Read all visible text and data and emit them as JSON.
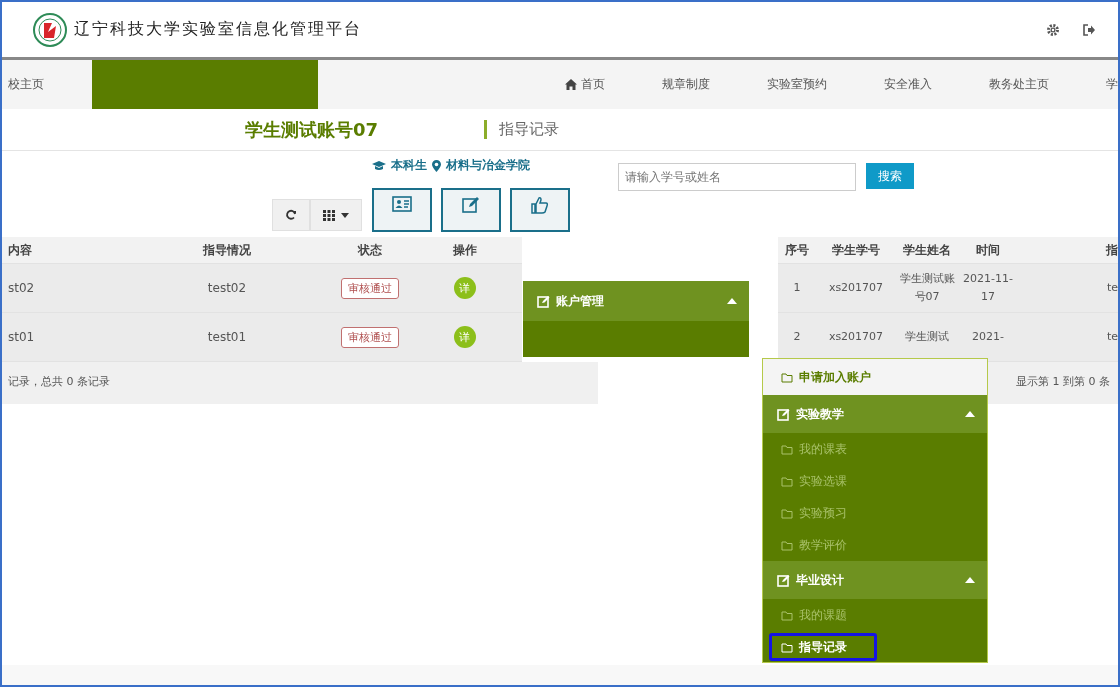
{
  "header": {
    "title": "辽宁科技大学实验室信息化管理平台"
  },
  "nav": {
    "items": [
      {
        "label": "校主页",
        "kind": "link"
      },
      {
        "label": "首页",
        "kind": "home"
      },
      {
        "label": "规章制度",
        "kind": "link"
      },
      {
        "label": "实验室预约",
        "kind": "link"
      },
      {
        "label": "安全准入",
        "kind": "link"
      },
      {
        "label": "教务处主页",
        "kind": "link"
      },
      {
        "label": "学",
        "kind": "link"
      }
    ]
  },
  "profile": {
    "name": "学生测试账号07",
    "type": "本科生",
    "college": "材料与冶金学院"
  },
  "page_title": "指导记录",
  "search": {
    "placeholder": "请输入学号或姓名",
    "button": "搜索"
  },
  "left_table": {
    "columns": [
      "内容",
      "指导情况",
      "状态",
      "操作"
    ],
    "rows": [
      {
        "cells": [
          "st02",
          "test02",
          "审核通过",
          "详"
        ]
      },
      {
        "cells": [
          "st01",
          "test01",
          "审核通过",
          "详"
        ]
      }
    ],
    "footer": "记录，总共 0 条记录"
  },
  "right_table": {
    "columns": [
      "序号",
      "学生学号",
      "学生姓名",
      "时间",
      "指"
    ],
    "rows": [
      {
        "cells": [
          "1",
          "xs201707",
          "学生测试账号07",
          "2021-11-17",
          "te"
        ]
      },
      {
        "cells": [
          "2",
          "xs201707",
          "学生测试",
          "2021-",
          "te"
        ]
      }
    ],
    "footer": "显示第 1 到第 0 条"
  },
  "account_menu": {
    "label": "账户管理",
    "expanded": true
  },
  "sidebar": {
    "items": [
      {
        "label": "申请加入账户",
        "kind": "link",
        "selected": false
      },
      {
        "label": "实验教学",
        "kind": "group",
        "expanded": true,
        "children": [
          {
            "label": "我的课表",
            "selected": false
          },
          {
            "label": "实验选课",
            "selected": false
          },
          {
            "label": "实验预习",
            "selected": false
          },
          {
            "label": "教学评价",
            "selected": false
          }
        ]
      },
      {
        "label": "毕业设计",
        "kind": "group",
        "expanded": true,
        "children": [
          {
            "label": "我的课题",
            "selected": false
          },
          {
            "label": "指导记录",
            "selected": true
          }
        ]
      }
    ]
  }
}
